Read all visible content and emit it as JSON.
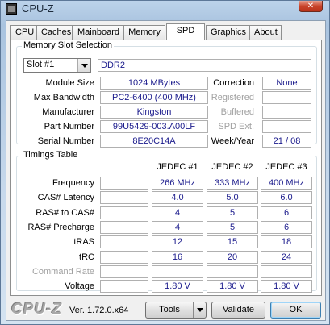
{
  "window": {
    "title": "CPU-Z",
    "close_glyph": "✕"
  },
  "tabs": [
    "CPU",
    "Caches",
    "Mainboard",
    "Memory",
    "SPD",
    "Graphics",
    "About"
  ],
  "active_tab": "SPD",
  "memory_slot_selection": {
    "legend": "Memory Slot Selection",
    "slot_select": {
      "value": "Slot #1"
    },
    "memory_type": "DDR2",
    "rows": [
      {
        "label": "Module Size",
        "value": "1024 MBytes"
      },
      {
        "label": "Max Bandwidth",
        "value": "PC2-6400 (400 MHz)"
      },
      {
        "label": "Manufacturer",
        "value": "Kingston"
      },
      {
        "label": "Part Number",
        "value": "99U5429-003.A00LF"
      },
      {
        "label": "Serial Number",
        "value": "8E20C14A"
      }
    ],
    "right_rows": [
      {
        "label": "Correction",
        "value": "None",
        "enabled": true
      },
      {
        "label": "Registered",
        "value": "",
        "enabled": false
      },
      {
        "label": "Buffered",
        "value": "",
        "enabled": false
      },
      {
        "label": "SPD Ext.",
        "value": "",
        "enabled": false
      },
      {
        "label": "Week/Year",
        "value": "21 / 08",
        "enabled": true
      }
    ]
  },
  "timings_table": {
    "legend": "Timings Table",
    "columns": [
      "JEDEC #1",
      "JEDEC #2",
      "JEDEC #3"
    ],
    "rows": [
      {
        "label": "Frequency",
        "values": [
          "266 MHz",
          "333 MHz",
          "400 MHz"
        ],
        "enabled": true
      },
      {
        "label": "CAS# Latency",
        "values": [
          "4.0",
          "5.0",
          "6.0"
        ],
        "enabled": true
      },
      {
        "label": "RAS# to CAS#",
        "values": [
          "4",
          "5",
          "6"
        ],
        "enabled": true
      },
      {
        "label": "RAS# Precharge",
        "values": [
          "4",
          "5",
          "6"
        ],
        "enabled": true
      },
      {
        "label": "tRAS",
        "values": [
          "12",
          "15",
          "18"
        ],
        "enabled": true
      },
      {
        "label": "tRC",
        "values": [
          "16",
          "20",
          "24"
        ],
        "enabled": true
      },
      {
        "label": "Command Rate",
        "values": [
          "",
          "",
          ""
        ],
        "enabled": false
      },
      {
        "label": "Voltage",
        "values": [
          "1.80 V",
          "1.80 V",
          "1.80 V"
        ],
        "enabled": true
      }
    ]
  },
  "footer": {
    "logo": "CPU-Z",
    "version": "Ver. 1.72.0.x64",
    "tools_label": "Tools",
    "validate_label": "Validate",
    "ok_label": "OK"
  }
}
